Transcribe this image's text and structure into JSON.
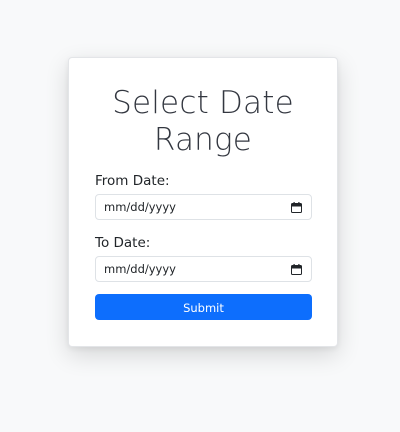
{
  "form": {
    "title_line1": "Select Date",
    "title_line2": "Range",
    "from_label": "From Date:",
    "from_placeholder": "mm/dd/yyyy",
    "to_label": "To Date:",
    "to_placeholder": "mm/dd/yyyy",
    "submit_label": "Submit"
  },
  "icons": {
    "date_picker": "calendar-icon"
  },
  "colors": {
    "accent": "#0d6efd",
    "page_background": "#f8f9fa",
    "card_background": "#ffffff"
  }
}
